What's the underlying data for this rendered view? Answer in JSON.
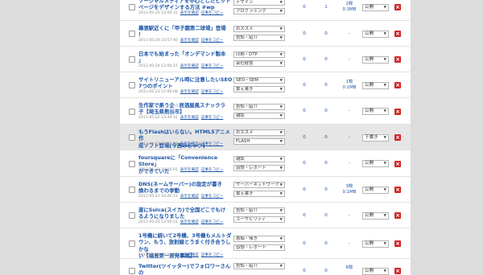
{
  "rows": [
    {
      "title": "ソーシャルメディアを中心としたヒット\nページをデザインする方法 #wp",
      "date": "2011-05-25 12:00:31",
      "cats": [
        "デザイン",
        "プログラミング"
      ],
      "n1": "0",
      "n2": "1",
      "size": "2枚\n0.3MB",
      "status": "公開",
      "highlight": false
    },
    {
      "title": "幕張駅近くに「甲子園第二球場」登場\n！",
      "date": "2011-05-24 23:57:40",
      "cats": [
        "おススメ",
        "告知・紹介"
      ],
      "n1": "0",
      "n2": "0",
      "size": "-",
      "status": "公開",
      "highlight": false
    },
    {
      "title": "日本でも始まった「オンデマンド製本\n」",
      "date": "2011-05-24 12:00:27",
      "cats": [
        "印刷・DTP",
        "会社経営"
      ],
      "n1": "0",
      "n2": "0",
      "size": "-",
      "status": "公開",
      "highlight": false
    },
    {
      "title": "サイトリニューアル時に注意したいSEO\n7つのポイント",
      "date": "2011-05-23 12:00:08",
      "cats": [
        "SEO・SEM",
        "實え書き"
      ],
      "n1": "0",
      "n2": "0",
      "size": "1枚\n0.1MB",
      "status": "公開",
      "highlight": false
    },
    {
      "title": "生作家で楽う企☆居酒屋風スナックラ\n子【埼玉県熊谷市】",
      "date": "2011-05-22 23:49:31",
      "cats": [
        "告知・紹介",
        "雑談"
      ],
      "n1": "0",
      "n2": "0",
      "size": "-",
      "status": "公開",
      "highlight": false
    },
    {
      "title": "もうFlashはいらない。HTML5アニメ作\n成ソフト登場[今週のピック]",
      "date": "2011-05-22 16:22:28",
      "cats": [
        "おススメ",
        "FLASH"
      ],
      "n1": "0",
      "n2": "0",
      "size": "-",
      "status": "下書き",
      "highlight": true
    },
    {
      "title": "foursquareに「Convenience Store」\nができていた",
      "date": "2011-05-21 16:00:01",
      "cats": [
        "雑談",
        "感想・レポート"
      ],
      "n1": "0",
      "n2": "0",
      "size": "-",
      "status": "公開",
      "highlight": false
    },
    {
      "title": "DNS(ネームサーバー)の設定が書き\n換わるまでの挙動",
      "date": "2011-05-21 16:00:12",
      "cats": [
        "サーバーネットワーク",
        "實え書き"
      ],
      "n1": "0",
      "n2": "0",
      "size": "3枚\n0.1MB",
      "status": "公開",
      "highlight": false
    },
    {
      "title": "遂にSuica(スイカ)で全国どこでもけ\nるようになりました",
      "date": "2011-05-20 12:00:31",
      "cats": [
        "告知・紹介",
        "ユーザビリティ"
      ],
      "n1": "0",
      "n2": "0",
      "size": "-",
      "status": "公開",
      "highlight": false
    },
    {
      "title": "1号機に続いて2号機、3号機もメルトダ\nウン、もう、放射線とうまく付き合うしかな\nい【福島第一原発事故】",
      "date": "2011-05-19 17:00:53",
      "cats": [
        "愚痴・嘆き",
        "感想・レポート"
      ],
      "n1": "0",
      "n2": "0",
      "size": "-",
      "status": "公開",
      "highlight": false
    },
    {
      "title": "Twitter(ツイッター)でフォロワーさんの\n出入りが分かる「人事た一」",
      "date": "",
      "cats": [
        "告知・紹介",
        ""
      ],
      "n1": "0",
      "n2": "0",
      "size": "6枚\n",
      "status": "公開",
      "highlight": false
    }
  ],
  "links": {
    "preview": "表示を確認",
    "copy": "記事をコピー"
  },
  "icons": {
    "delete": "delete-x-icon",
    "dropdown": "chevron-down-icon",
    "checkbox": "checkbox"
  },
  "colors": {
    "link": "#1a54a8",
    "delete": "#d02424",
    "page_bg": "#dcdcdc",
    "highlight_row": "#e6e6e6"
  }
}
